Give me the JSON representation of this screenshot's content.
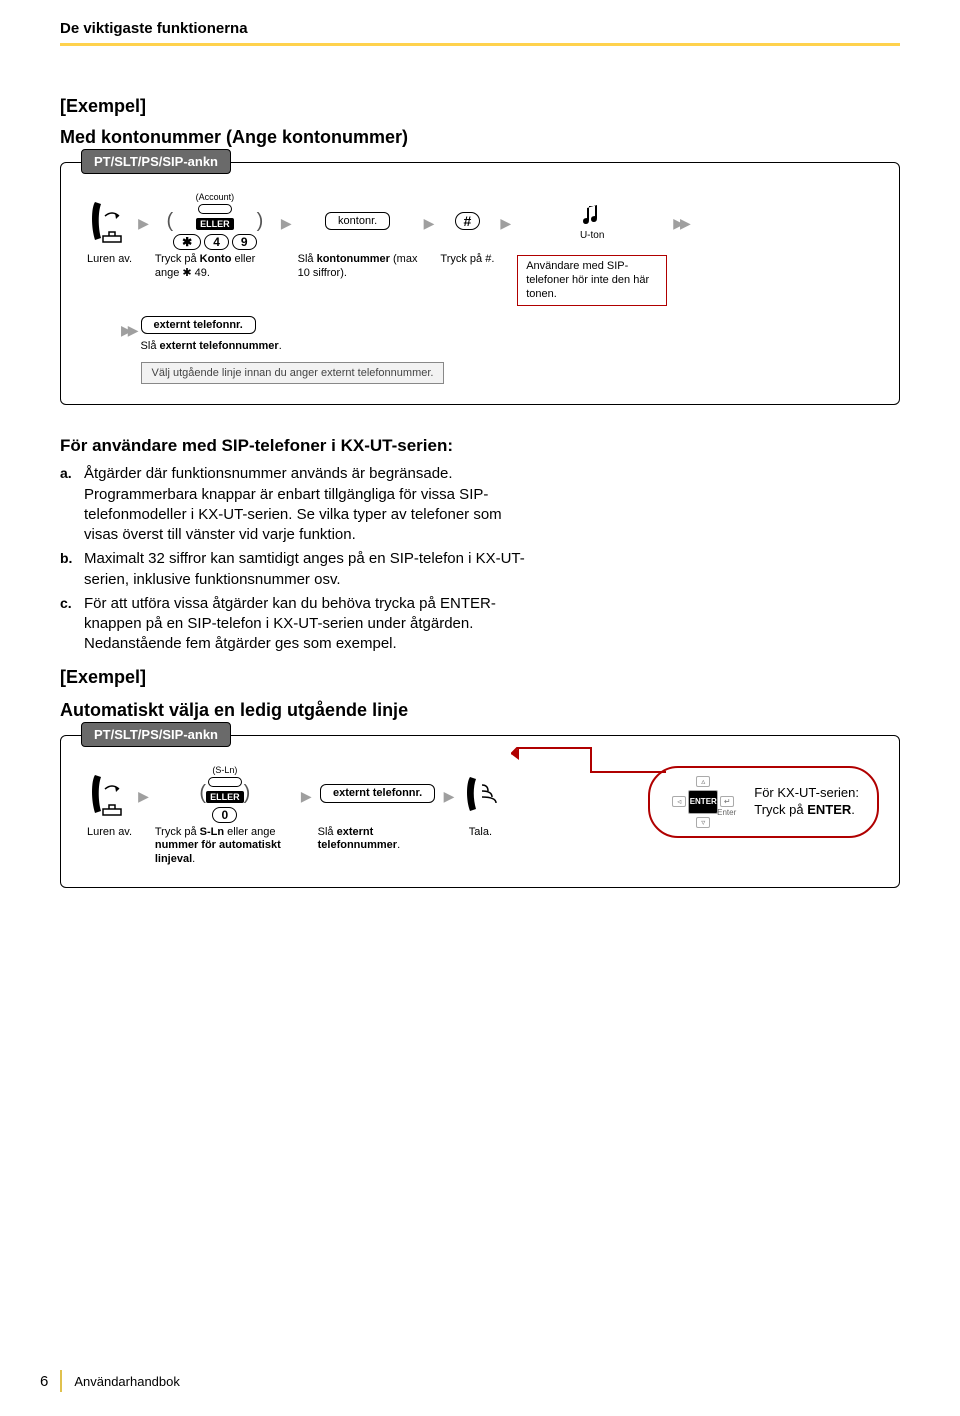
{
  "header": "De viktigaste funktionerna",
  "ex1": {
    "label": "[Exempel]",
    "title": "Med kontonummer (Ange kontonummer)",
    "tab": "PT/SLT/PS/SIP-ankn",
    "account_label": "(Account)",
    "eller": "ELLER",
    "key4": "4",
    "key9": "9",
    "star": "✱",
    "kontonr": "kontonr.",
    "hash": "#",
    "uton": "U-ton",
    "cap_luren": "Luren av.",
    "cap_konto_pre": "Tryck på ",
    "cap_konto_b": "Konto",
    "cap_konto_post": " eller ange ✱ 49.",
    "cap_sla_pre": "Slå ",
    "cap_sla_b": "kontonummer",
    "cap_sla_post": " (max 10 siffror).",
    "cap_hash": "Tryck på #.",
    "note_sip": "Användare med SIP-telefoner hör inte den här tonen.",
    "ext_box": "externt telefonnr.",
    "cap_ext_pre": "Slå ",
    "cap_ext_b": "externt telefonnummer",
    "cap_ext_post": ".",
    "hint": "Välj utgående linje innan du anger externt telefonnummer."
  },
  "body": {
    "h": "För användare med SIP-telefoner i KX-UT-serien:",
    "a_m": "a.",
    "a": "Åtgärder där funktionsnummer används är begränsade. Programmerbara knappar är enbart tillgängliga för vissa SIP-telefonmodeller i KX-UT-serien. Se vilka typer av telefoner som visas överst till vänster vid varje funktion.",
    "b_m": "b.",
    "b": "Maximalt 32 siffror kan samtidigt anges på en SIP-telefon i KX-UT-serien, inklusive funktionsnummer osv.",
    "c_m": "c.",
    "c1": "För att utföra vissa åtgärder kan du behöva trycka på ENTER-knappen på en SIP-telefon i KX-UT-serien under åtgärden.",
    "c2": "Nedanstående fem åtgärder ges som exempel."
  },
  "ex2": {
    "label": "[Exempel]",
    "title": "Automatiskt välja en ledig utgående linje",
    "tab": "PT/SLT/PS/SIP-ankn",
    "sln": "(S-Ln)",
    "eller": "ELLER",
    "zero": "0",
    "ext_box": "externt telefonnr.",
    "enter": "ENTER",
    "enter_lbl": "Enter",
    "kx_line1": "För KX-UT-serien:",
    "kx_line2_pre": "Tryck på ",
    "kx_line2_b": "ENTER",
    "kx_line2_post": ".",
    "cap_luren": "Luren av.",
    "cap_sln_pre": "Tryck på ",
    "cap_sln_b": "S-Ln",
    "cap_sln_mid": " eller ange ",
    "cap_sln_b2": "nummer för automatiskt linjeval",
    "cap_sln_post": ".",
    "cap_ext_pre": "Slå ",
    "cap_ext_b": "externt telefonnummer",
    "cap_ext_post": ".",
    "cap_tala": "Tala."
  },
  "footer": {
    "page": "6",
    "book": "Användarhandbok"
  }
}
